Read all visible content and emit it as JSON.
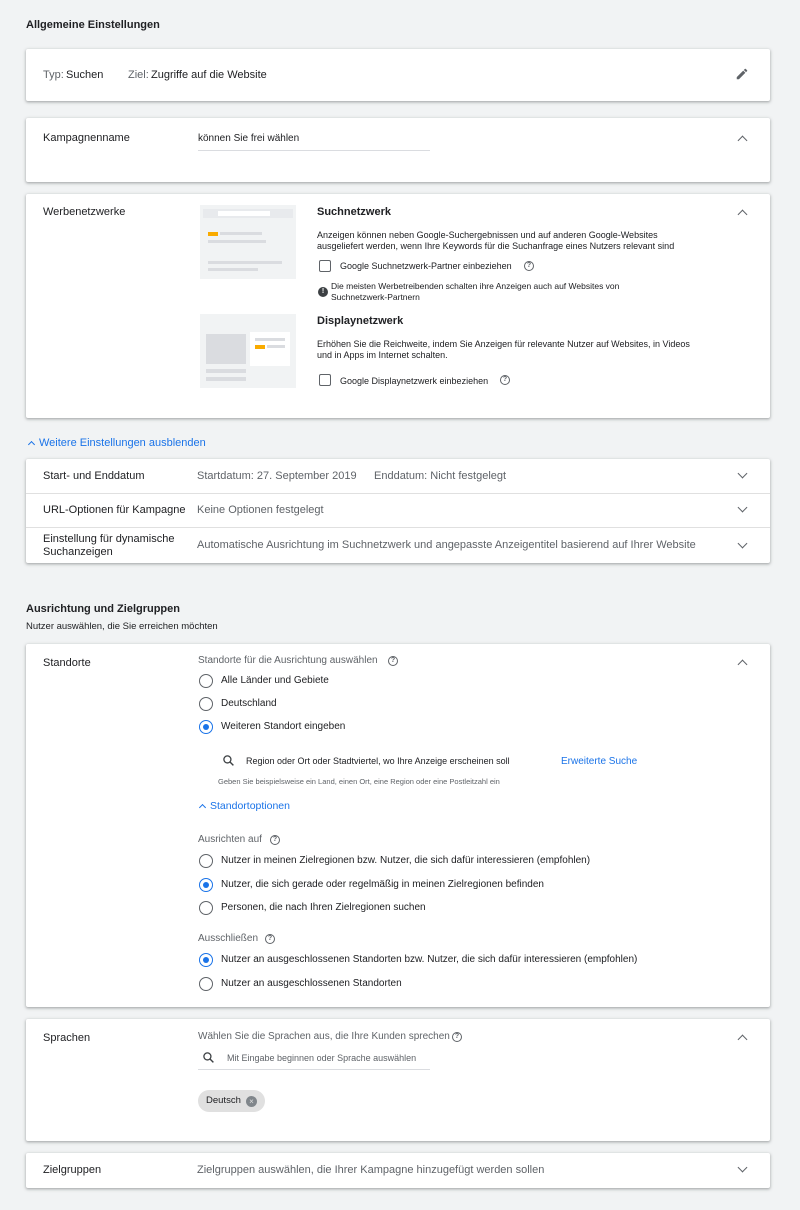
{
  "general": {
    "title": "Allgemeine Einstellungen",
    "typ_label": "Typ:",
    "typ_value": "Suchen",
    "ziel_label": "Ziel:",
    "ziel_value": "Zugriffe auf die Website"
  },
  "campaign_name": {
    "label": "Kampagnenname",
    "value": "können Sie frei wählen"
  },
  "networks": {
    "label": "Werbenetzwerke",
    "search_title": "Suchnetzwerk",
    "search_desc_1": "Anzeigen können neben Google-Suchergebnissen und auf anderen Google-Websites",
    "search_desc_2": "ausgeliefert werden, wenn Ihre Keywords für die Suchanfrage eines Nutzers relevant sind",
    "search_partner_label": "Google Suchnetzwerk-Partner einbeziehen",
    "info_1": "Die meisten Werbetreibenden schalten ihre Anzeigen auch auf Websites von",
    "info_2": "Suchnetzwerk-Partnern",
    "display_title": "Displaynetzwerk",
    "display_desc_1": "Erhöhen Sie die Reichweite, indem Sie Anzeigen für relevante Nutzer auf Websites, in Videos",
    "display_desc_2": "und in Apps im Internet schalten.",
    "display_label": "Google Displaynetzwerk einbeziehen"
  },
  "more_settings_link": "Weitere Einstellungen ausblenden",
  "settings_rows": [
    {
      "label": "Start- und Enddatum",
      "value": "Startdatum: 27. September 2019",
      "value2": "Enddatum: Nicht festgelegt"
    },
    {
      "label": "URL-Optionen für Kampagne",
      "value": "Keine Optionen festgelegt"
    },
    {
      "label_1": "Einstellung für dynamische",
      "label_2": "Suchanzeigen",
      "value": "Automatische Ausrichtung im Suchnetzwerk und angepasste Anzeigentitel basierend auf Ihrer Website"
    }
  ],
  "targeting": {
    "title": "Ausrichtung und Zielgruppen",
    "subtitle": "Nutzer auswählen, die Sie erreichen möchten"
  },
  "locations": {
    "label": "Standorte",
    "prompt": "Standorte für die Ausrichtung auswählen",
    "options": [
      "Alle Länder und Gebiete",
      "Deutschland",
      "Weiteren Standort eingeben"
    ],
    "selected_index": 2,
    "search_placeholder": "Region oder Ort oder Stadtviertel, wo Ihre Anzeige erscheinen soll",
    "advanced_search": "Erweiterte Suche",
    "search_hint": "Geben Sie beispielsweise ein Land, einen Ort, eine Region oder eine Postleitzahl ein",
    "options_link": "Standortoptionen",
    "target_label": "Ausrichten auf",
    "target_options": [
      "Nutzer in meinen Zielregionen bzw. Nutzer, die sich dafür interessieren (empfohlen)",
      "Nutzer, die sich gerade oder regelmäßig in meinen Zielregionen befinden",
      "Personen, die nach Ihren Zielregionen suchen"
    ],
    "target_selected_index": 1,
    "exclude_label": "Ausschließen",
    "exclude_options": [
      "Nutzer an ausgeschlossenen Standorten bzw. Nutzer, die sich dafür interessieren (empfohlen)",
      "Nutzer an ausgeschlossenen Standorten"
    ],
    "exclude_selected_index": 0
  },
  "languages": {
    "label": "Sprachen",
    "prompt": "Wählen Sie die Sprachen aus, die Ihre Kunden sprechen",
    "search_placeholder": "Mit Eingabe beginnen oder Sprache auswählen",
    "chip": "Deutsch"
  },
  "audiences": {
    "label": "Zielgruppen",
    "value": "Zielgruppen auswählen, die Ihrer Kampagne hinzugefügt werden sollen"
  },
  "colors": {
    "accent": "#1a73e8",
    "background": "#f1f3f4",
    "card": "#ffffff",
    "text": "#202124",
    "muted": "#5f6368"
  },
  "icons": [
    "pencil-icon",
    "chevron-up-icon",
    "chevron-down-icon",
    "help-icon",
    "info-icon",
    "search-icon",
    "close-icon"
  ]
}
